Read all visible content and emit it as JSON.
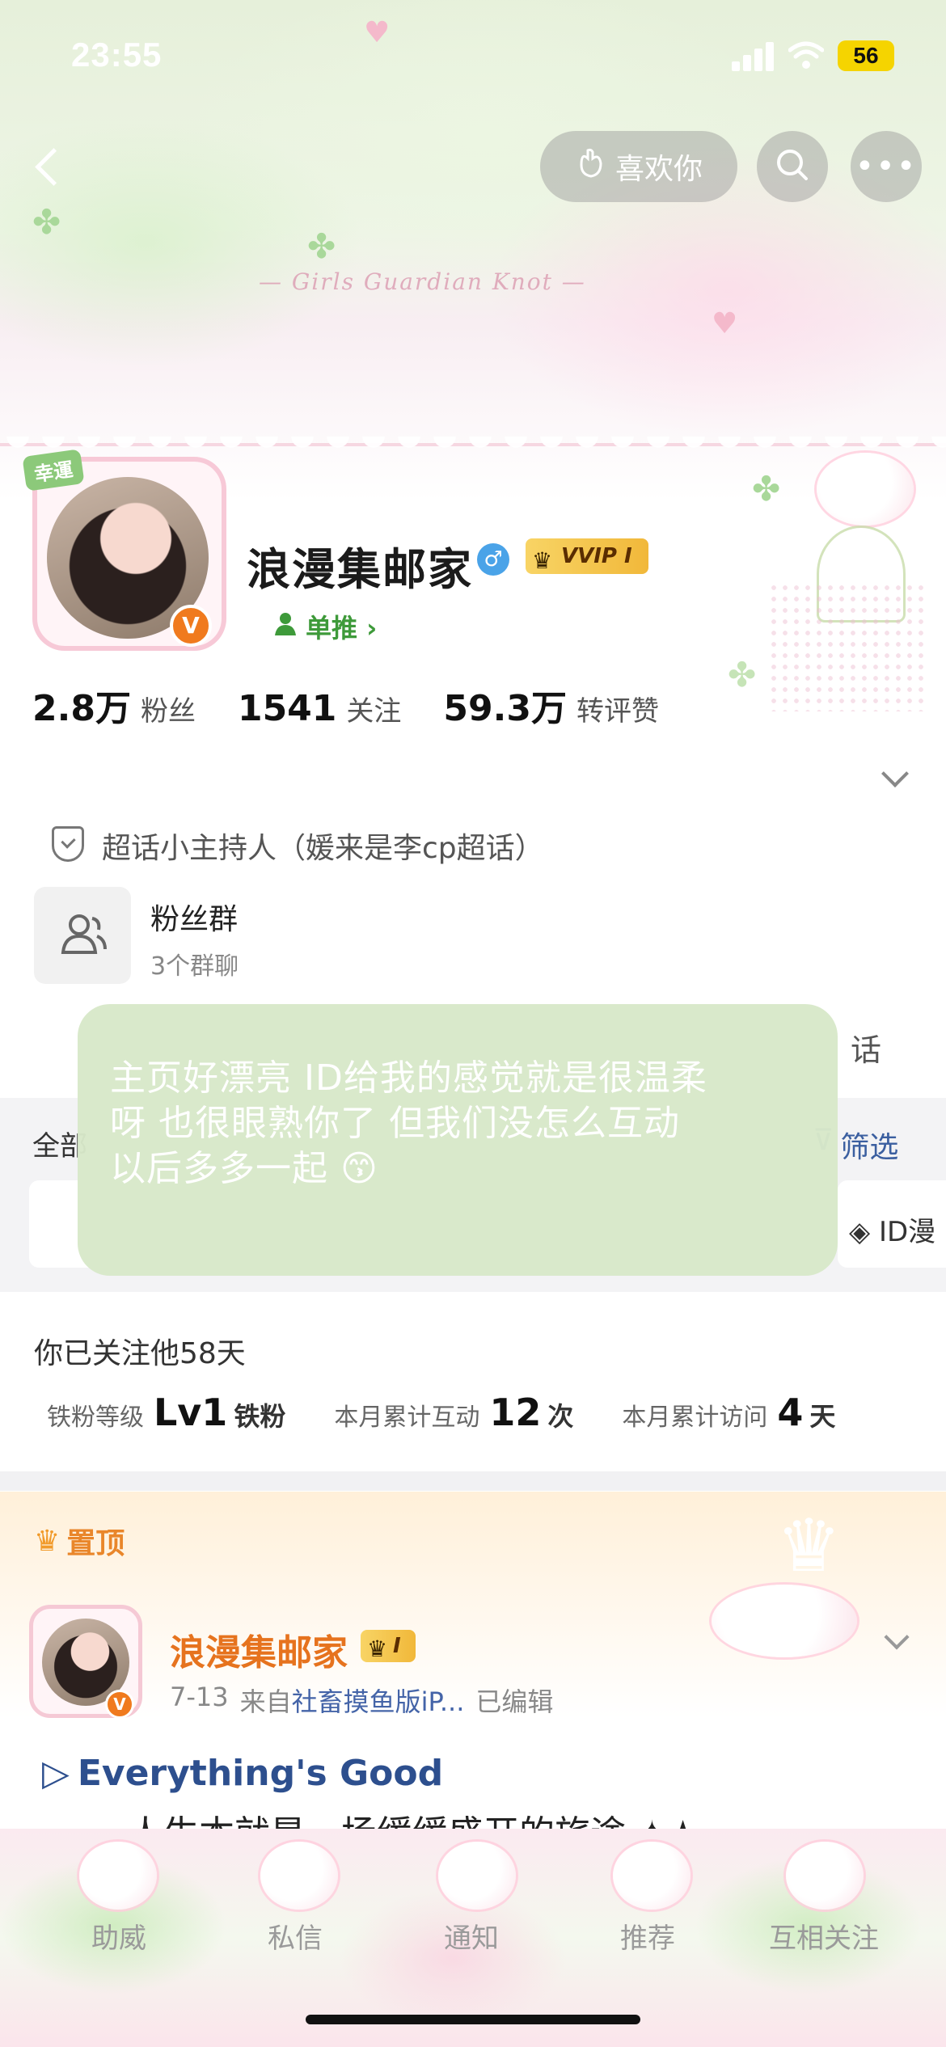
{
  "status_bar": {
    "time": "23:55",
    "battery": "56"
  },
  "nav": {
    "like_label": "喜欢你"
  },
  "profile": {
    "luck_tag": "幸運",
    "v_badge": "V",
    "name": "浪漫集邮家",
    "gender_symbol": "♂",
    "vip_label": "VVIP I",
    "tag_label": "单推 ›",
    "stats": [
      {
        "num": "2.8万",
        "label": "粉丝"
      },
      {
        "num": "1541",
        "label": "关注"
      },
      {
        "num": "59.3万",
        "label": "转评赞"
      }
    ]
  },
  "info": {
    "host": "超话小主持人（媛来是李cp超话）",
    "group_title": "粉丝群",
    "group_sub": "3个群聊",
    "partial_right": "话"
  },
  "filter": {
    "left_label": "全部",
    "right_label": "筛选",
    "chip_right": "ID漫"
  },
  "overlay_comment": {
    "lines": [
      "主页好漂亮 ID给我的感觉就是很温柔",
      "呀 也很眼熟你了 但我们没怎么互动",
      "以后多多一起 😙"
    ]
  },
  "follow": {
    "since": "你已关注他58天",
    "items": [
      {
        "label": "铁粉等级",
        "value": "Lv1",
        "unit": "铁粉"
      },
      {
        "label": "本月累计互动",
        "value": "12",
        "unit": "次"
      },
      {
        "label": "本月累计访问",
        "value": "4",
        "unit": "天"
      }
    ]
  },
  "pinned": {
    "label": "置顶",
    "author": "浪漫集邮家",
    "vip": "I",
    "date": "7-13",
    "from": "来自",
    "source": "社畜摸鱼版iP...",
    "edited": "已编辑",
    "title": "Everything's Good",
    "body": "人生本就是一场缓缓盛开的旅途 ✦★"
  },
  "tabbar": {
    "items": [
      "助威",
      "私信",
      "通知",
      "推荐",
      "互相关注"
    ]
  },
  "colors": {
    "accent_orange": "#e6731e",
    "link_blue": "#3b5fa0",
    "green_tag": "#3e9a3a",
    "overlay_green": "#d8e8c9"
  }
}
